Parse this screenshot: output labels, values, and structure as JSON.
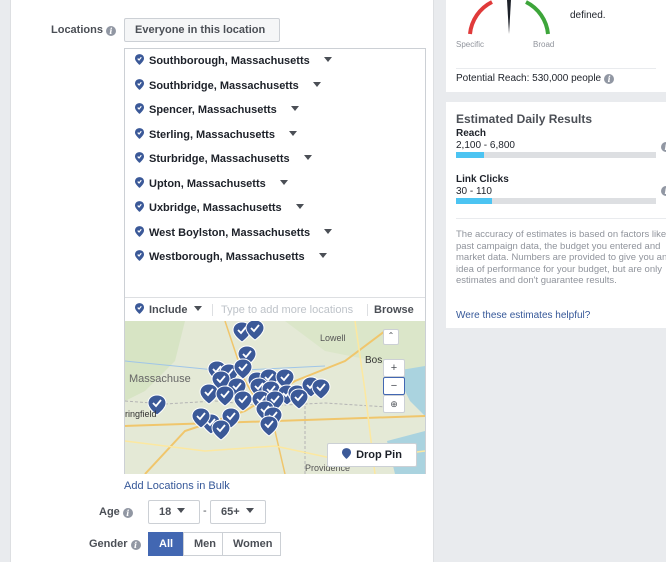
{
  "colors": {
    "accent": "#4267b2",
    "bar": "#4cc4f2",
    "link": "#365899",
    "pin": "#3b5998"
  },
  "targeting": {
    "locations_label": "Locations",
    "locations_dropdown": "Everyone in this location",
    "location_items": [
      "Southborough, Massachusetts",
      "Southbridge, Massachusetts",
      "Spencer, Massachusetts",
      "Sterling, Massachusetts",
      "Sturbridge, Massachusetts",
      "Upton, Massachusetts",
      "Uxbridge, Massachusetts",
      "West Boylston, Massachusetts",
      "Westborough, Massachusetts"
    ],
    "include_label": "Include",
    "location_search_placeholder": "Type to add more locations",
    "browse_label": "Browse",
    "map": {
      "drop_pin_label": "Drop Pin",
      "zoom_in": "+",
      "zoom_out": "−",
      "place_labels": [
        "Lowell",
        "Bos",
        "Massachuse",
        "ringfield",
        "Providence"
      ]
    },
    "add_bulk_label": "Add Locations in Bulk",
    "age_label": "Age",
    "age_min": "18",
    "age_separator": "-",
    "age_max": "65+",
    "gender_label": "Gender",
    "gender_options": [
      "All",
      "Men",
      "Women"
    ],
    "gender_selected": "All"
  },
  "audience": {
    "defined_text": "defined.",
    "gauge_left": "Specific",
    "gauge_right": "Broad",
    "potential_reach": "Potential Reach: 530,000 people"
  },
  "estimates": {
    "title": "Estimated Daily Results",
    "reach_label": "Reach",
    "reach_value": "2,100 - 6,800",
    "reach_fill": 0.14,
    "clicks_label": "Link Clicks",
    "clicks_value": "30 - 110",
    "clicks_fill": 0.18,
    "disclaimer": "The accuracy of estimates is based on factors like past campaign data, the budget you entered and market data. Numbers are provided to give you an idea of performance for your budget, but are only estimates and don't guarantee results.",
    "helpful_link": "Were these estimates helpful?"
  }
}
